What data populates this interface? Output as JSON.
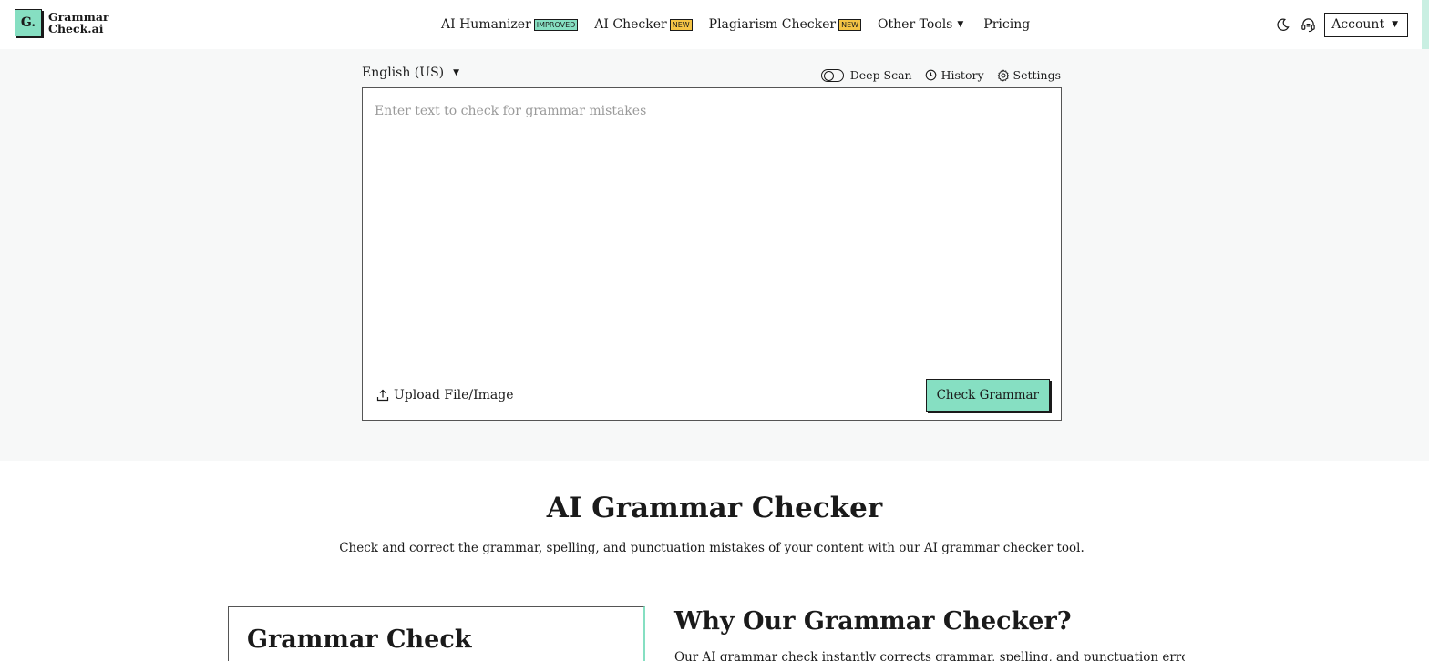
{
  "header": {
    "logo_mark": "G.",
    "logo_line1": "Grammar",
    "logo_line2": "Check.ai",
    "nav": [
      {
        "label": "AI Humanizer",
        "badge": "IMPROVED"
      },
      {
        "label": "AI Checker",
        "badge": "NEW"
      },
      {
        "label": "Plagiarism Checker",
        "badge": "NEW"
      },
      {
        "label": "Other Tools"
      },
      {
        "label": "Pricing"
      }
    ],
    "icons": [
      "moon-icon",
      "support-headset-icon"
    ],
    "account_label": "Account"
  },
  "tool": {
    "language": "English (US)",
    "deep_scan_label": "Deep Scan",
    "deep_scan_on": false,
    "history_label": "History",
    "settings_label": "Settings",
    "placeholder": "Enter text to check for grammar mistakes",
    "upload_label": "Upload File/Image",
    "check_label": "Check Grammar"
  },
  "content": {
    "title": "AI Grammar Checker",
    "subtitle": "Check and correct the grammar, spelling, and punctuation mistakes of your content with our AI grammar checker tool.",
    "card_title": "Grammar Check",
    "why_title": "Why Our Grammar Checker?",
    "why_text": "Our AI grammar check instantly corrects grammar, spelling, and punctuation errors. It"
  },
  "colors": {
    "accent": "#86dfc2",
    "badge_new": "#f5c445",
    "tool_bg": "#f7f8f8"
  }
}
